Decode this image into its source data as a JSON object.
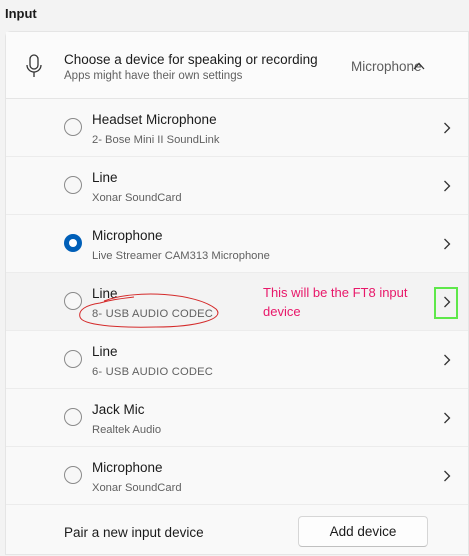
{
  "section": {
    "title": "Input"
  },
  "header": {
    "title": "Choose a device for speaking or recording",
    "subtitle": "Apps might have their own settings",
    "value": "Microphone",
    "icon": "microphone-icon",
    "expand_icon": "chevron-up-icon"
  },
  "devices": [
    {
      "name": "Headset Microphone",
      "detail": "2- Bose Mini II SoundLink",
      "selected": false
    },
    {
      "name": "Line",
      "detail": "Xonar SoundCard",
      "selected": false
    },
    {
      "name": "Microphone",
      "detail": "Live Streamer CAM313 Microphone",
      "selected": true
    },
    {
      "name": "Line",
      "detail": "8- USB AUDIO  CODEC",
      "selected": false
    },
    {
      "name": "Line",
      "detail": "6- USB AUDIO  CODEC",
      "selected": false
    },
    {
      "name": "Jack Mic",
      "detail": "Realtek Audio",
      "selected": false
    },
    {
      "name": "Microphone",
      "detail": "Xonar SoundCard",
      "selected": false
    }
  ],
  "annotation": {
    "text": "This will be the FT8 input device",
    "color": "#e8186a",
    "highlight_color": "#5ee84a"
  },
  "footer": {
    "label": "Pair a new input device",
    "button": "Add device"
  },
  "colors": {
    "accent": "#005fb8"
  }
}
